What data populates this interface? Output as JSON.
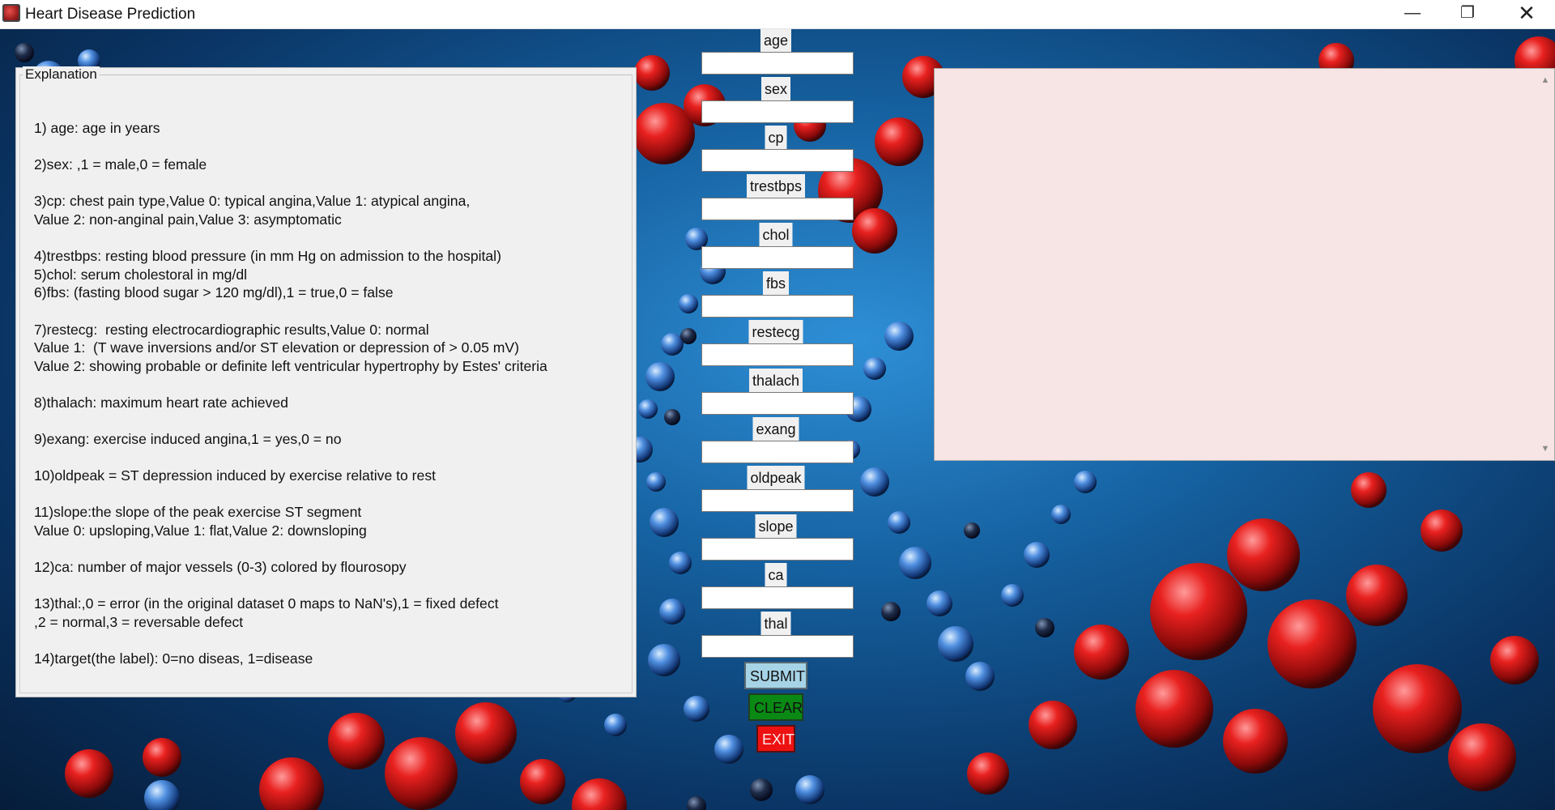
{
  "window": {
    "title": "Heart Disease Prediction",
    "minimize_glyph": "—",
    "maximize_glyph": "❐",
    "close_glyph": "✕"
  },
  "explanation": {
    "legend": "Explanation",
    "text": "1) age: age in years\n\n2)sex: ,1 = male,0 = female\n\n3)cp: chest pain type,Value 0: typical angina,Value 1: atypical angina,\nValue 2: non-anginal pain,Value 3: asymptomatic\n\n4)trestbps: resting blood pressure (in mm Hg on admission to the hospital)\n5)chol: serum cholestoral in mg/dl\n6)fbs: (fasting blood sugar > 120 mg/dl),1 = true,0 = false\n\n7)restecg:  resting electrocardiographic results,Value 0: normal\nValue 1:  (T wave inversions and/or ST elevation or depression of > 0.05 mV)\nValue 2: showing probable or definite left ventricular hypertrophy by Estes' criteria\n\n8)thalach: maximum heart rate achieved\n\n9)exang: exercise induced angina,1 = yes,0 = no\n\n10)oldpeak = ST depression induced by exercise relative to rest\n\n11)slope:the slope of the peak exercise ST segment\nValue 0: upsloping,Value 1: flat,Value 2: downsloping\n\n12)ca: number of major vessels (0-3) colored by flourosopy\n\n13)thal:,0 = error (in the original dataset 0 maps to NaN's),1 = fixed defect\n,2 = normal,3 = reversable defect\n\n14)target(the label): 0=no diseas, 1=disease"
  },
  "form": {
    "fields": [
      {
        "label": "age",
        "value": ""
      },
      {
        "label": "sex",
        "value": ""
      },
      {
        "label": "cp",
        "value": ""
      },
      {
        "label": "trestbps",
        "value": ""
      },
      {
        "label": "chol",
        "value": ""
      },
      {
        "label": "fbs",
        "value": ""
      },
      {
        "label": "restecg",
        "value": ""
      },
      {
        "label": "thalach",
        "value": ""
      },
      {
        "label": "exang",
        "value": ""
      },
      {
        "label": "oldpeak",
        "value": ""
      },
      {
        "label": "slope",
        "value": ""
      },
      {
        "label": "ca",
        "value": ""
      },
      {
        "label": "thal",
        "value": ""
      }
    ],
    "submit_label": "SUBMIT",
    "clear_label": "CLEAR",
    "exit_label": "EXIT"
  },
  "result": {
    "text": ""
  },
  "colors": {
    "submit_bg": "#a6d4e6",
    "clear_bg": "#0a8a14",
    "exit_bg": "#ee1111",
    "result_bg": "#f7e4e4",
    "panel_bg": "#f0f0f0"
  }
}
